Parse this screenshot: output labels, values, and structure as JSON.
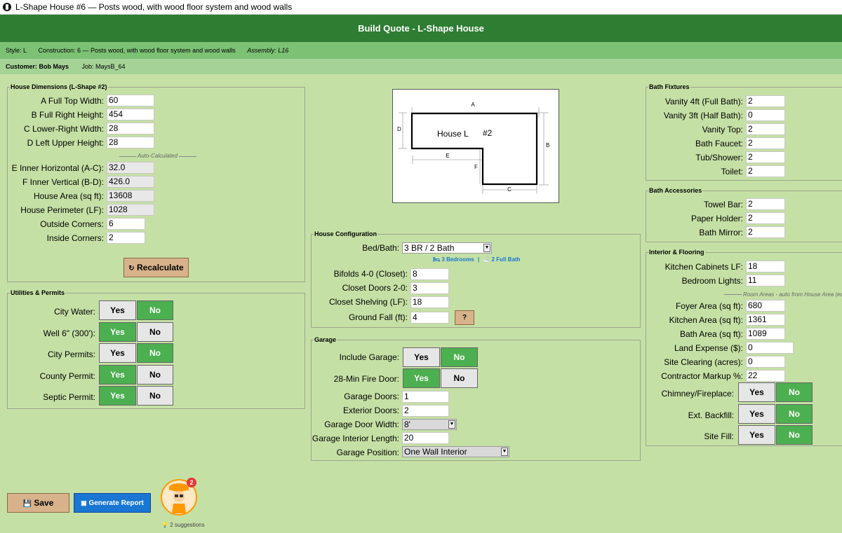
{
  "window": {
    "title": "L-Shape House #6 — Posts wood, with wood floor system and wood walls"
  },
  "header": {
    "title": "Build Quote - L-Shape House"
  },
  "info": {
    "style": "Style: L",
    "construction": "Construction: 6 — Posts wood, with wood floor system and wood walls",
    "assembly": "Assembly: L16"
  },
  "customer": {
    "name": "Customer: Bob Mays",
    "job": "Job: MaysB_64"
  },
  "dimensions": {
    "title": "House Dimensions  (L-Shape #2)",
    "fields": [
      {
        "label": "A  Full Top Width:",
        "value": "60"
      },
      {
        "label": "B  Full Right Height:",
        "value": "454"
      },
      {
        "label": "C  Lower-Right Width:",
        "value": "28"
      },
      {
        "label": "D  Left Upper Height:",
        "value": "28"
      }
    ],
    "auto_label": "Auto-Calculated",
    "calc": [
      {
        "label": "E  Inner Horizontal (A-C):",
        "value": "32.0"
      },
      {
        "label": "F  Inner Vertical (B-D):",
        "value": "426.0"
      },
      {
        "label": "House Area (sq ft):",
        "value": "13608"
      },
      {
        "label": "House Perimeter (LF):",
        "value": "1028"
      }
    ],
    "corners": [
      {
        "label": "Outside Corners:",
        "value": "6"
      },
      {
        "label": "Inside Corners:",
        "value": "2"
      }
    ],
    "recalc_label": "Recalculate"
  },
  "utilities": {
    "title": "Utilities & Permits",
    "rows": [
      {
        "label": "City Water:",
        "yes": "Yes",
        "no": "No",
        "selected": "no"
      },
      {
        "label": "Well 6\" (300'):",
        "yes": "Yes",
        "no": "No",
        "selected": "yes"
      },
      {
        "label": "City Permits:",
        "yes": "Yes",
        "no": "No",
        "selected": "no"
      },
      {
        "label": "County Permit:",
        "yes": "Yes",
        "no": "No",
        "selected": "yes"
      },
      {
        "label": "Septic Permit:",
        "yes": "Yes",
        "no": "No",
        "selected": "yes"
      }
    ]
  },
  "diagram": {
    "a": "A",
    "b": "B",
    "c": "C",
    "d": "D",
    "e": "E",
    "f": "F",
    "house_label": "House  L",
    "number": "#2"
  },
  "config": {
    "title": "House Configuration",
    "bedbath_label": "Bed/Bath:",
    "bedbath_value": "3 BR / 2 Bath",
    "bedrooms": "3 Bedrooms",
    "separator": "|",
    "baths": "2 Full Bath",
    "fields": [
      {
        "label": "Bifolds 4-0 (Closet):",
        "value": "8"
      },
      {
        "label": "Closet Doors 2-0:",
        "value": "3"
      },
      {
        "label": "Closet Shelving (LF):",
        "value": "18"
      },
      {
        "label": "Ground Fall (ft):",
        "value": "4"
      }
    ],
    "help_label": "?"
  },
  "garage": {
    "title": "Garage",
    "include_label": "Include Garage:",
    "include_selected": "no",
    "firedoor_label": "28-Min Fire Door:",
    "firedoor_selected": "yes",
    "yes": "Yes",
    "no": "No",
    "doors_label": "Garage Doors:",
    "doors_value": "1",
    "ext_label": "Exterior Doors:",
    "ext_value": "2",
    "width_label": "Garage Door Width:",
    "width_value": "8'",
    "length_label": "Garage Interior Length:",
    "length_value": "20",
    "position_label": "Garage Position:",
    "position_value": "One Wall Interior"
  },
  "bath_fixtures": {
    "title": "Bath Fixtures",
    "fields": [
      {
        "label": "Vanity 4ft (Full Bath):",
        "value": "2"
      },
      {
        "label": "Vanity 3ft (Half Bath):",
        "value": "0"
      },
      {
        "label": "Vanity Top:",
        "value": "2"
      },
      {
        "label": "Bath Faucet:",
        "value": "2"
      },
      {
        "label": "Tub/Shower:",
        "value": "2"
      },
      {
        "label": "Toilet:",
        "value": "2"
      }
    ]
  },
  "bath_accessories": {
    "title": "Bath Accessories",
    "fields": [
      {
        "label": "Towel Bar:",
        "value": "2"
      },
      {
        "label": "Paper Holder:",
        "value": "2"
      },
      {
        "label": "Bath Mirror:",
        "value": "2"
      }
    ]
  },
  "interior": {
    "title": "Interior & Flooring",
    "fields": [
      {
        "label": "Kitchen Cabinets LF:",
        "value": "18"
      },
      {
        "label": "Bedroom Lights:",
        "value": "11"
      }
    ],
    "room_note": "Room Areas - auto from House Area (editable)",
    "rooms": [
      {
        "label": "Foyer Area (sq ft):",
        "value": "680"
      },
      {
        "label": "Kitchen Area (sq ft):",
        "value": "1361"
      },
      {
        "label": "Bath Area (sq ft):",
        "value": "1089"
      },
      {
        "label": "Land Expense ($):",
        "value": "0"
      },
      {
        "label": "Site Clearing (acres):",
        "value": "0"
      },
      {
        "label": "Contractor Markup %:",
        "value": "22"
      }
    ],
    "toggles": [
      {
        "label": "Chimney/Fireplace:",
        "yes": "Yes",
        "no": "No",
        "selected": "no"
      },
      {
        "label": "Ext. Backfill:",
        "yes": "Yes",
        "no": "No",
        "selected": "no"
      },
      {
        "label": "Site Fill:",
        "yes": "Yes",
        "no": "No",
        "selected": "no"
      }
    ]
  },
  "footer": {
    "save_label": "Save",
    "report_label": "Generate Report",
    "badge": "2",
    "suggestions": "2 suggestions"
  },
  "colors": {
    "header": "#2e7d32",
    "selected": "#4caf50",
    "background": "#c5e0a5",
    "report": "#1976d2"
  }
}
